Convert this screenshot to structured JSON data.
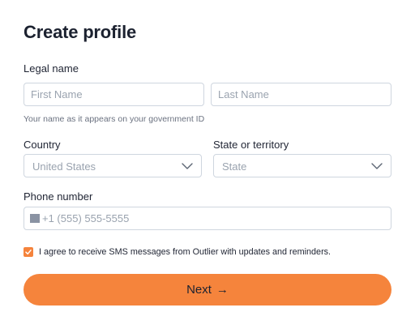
{
  "form": {
    "title": "Create profile",
    "legal_name": {
      "label": "Legal name",
      "first_placeholder": "First Name",
      "last_placeholder": "Last Name",
      "first_value": "",
      "last_value": "",
      "helper": "Your name as it appears on your government ID"
    },
    "country": {
      "label": "Country",
      "selected": "United States",
      "icon": "chevron-down-icon"
    },
    "state": {
      "label": "State or territory",
      "selected": "State",
      "icon": "chevron-down-icon"
    },
    "phone": {
      "label": "Phone number",
      "placeholder": "+1 (555) 555-5555",
      "value": "",
      "flag_icon": "flag-icon"
    },
    "consent": {
      "checked": true,
      "text": "I agree to receive SMS messages from Outlier with updates and reminders."
    },
    "next_button": {
      "label": "Next",
      "arrow": "→"
    }
  },
  "colors": {
    "accent": "#f5843c",
    "border": "#cfd6df",
    "placeholder": "#9aa3af",
    "text": "#1f2433",
    "helper": "#6b7280"
  }
}
